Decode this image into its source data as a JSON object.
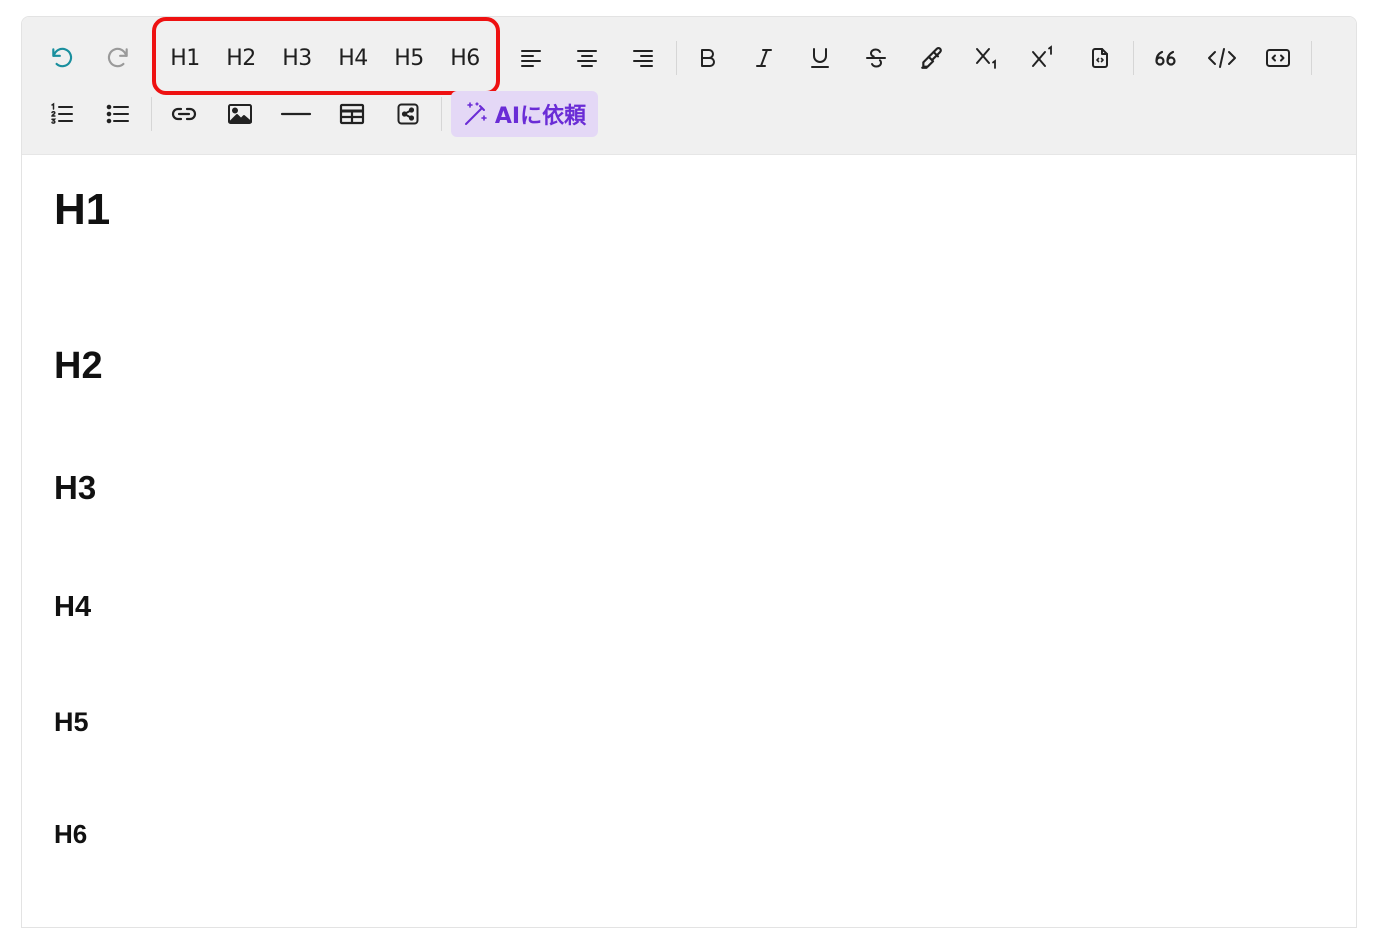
{
  "toolbar": {
    "history": [
      {
        "name": "undo-icon",
        "state": "enabled"
      },
      {
        "name": "redo-icon",
        "state": "disabled"
      }
    ],
    "headings": [
      "H1",
      "H2",
      "H3",
      "H4",
      "H5",
      "H6"
    ],
    "align": [
      "align-left-icon",
      "align-center-icon",
      "align-right-icon"
    ],
    "format": [
      "bold-icon",
      "italic-icon",
      "underline-icon",
      "strikethrough-icon",
      "highlighter-icon",
      "subscript-icon",
      "superscript-icon",
      "code-file-icon"
    ],
    "insert": [
      "blockquote-icon",
      "code-icon",
      "code-block-icon"
    ],
    "lists": [
      "ordered-list-icon",
      "bullet-list-icon"
    ],
    "media": [
      "link-icon",
      "image-icon",
      "horizontal-rule-icon",
      "table-icon",
      "embed-icon"
    ],
    "ai_button_label": "AIに依頼",
    "ai_color": "#6a2cd6",
    "highlight_color": "#ee1111"
  },
  "document": {
    "h1": "H1",
    "h2": "H2",
    "h3": "H3",
    "h4": "H4",
    "h5": "H5",
    "h6": "H6"
  }
}
